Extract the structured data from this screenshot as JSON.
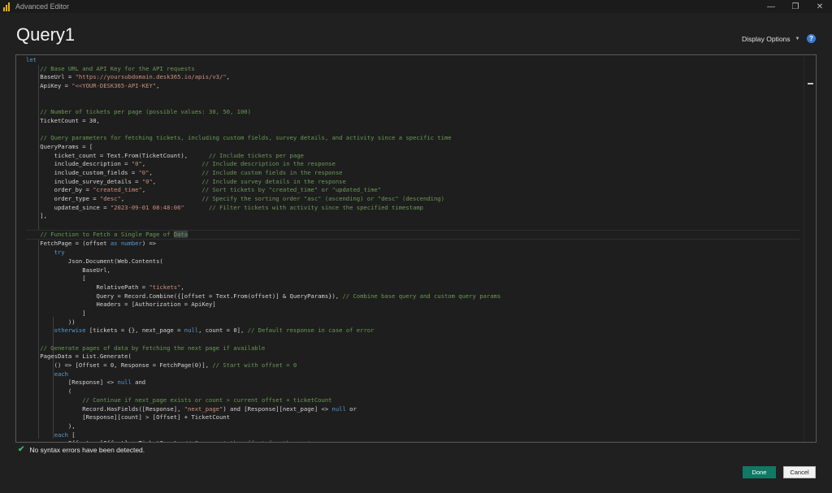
{
  "window": {
    "title": "Advanced Editor",
    "controls": {
      "minimize": "—",
      "restore": "❐",
      "close": "✕"
    }
  },
  "header": {
    "query_name": "Query1",
    "display_options_label": "Display Options",
    "help_label": "?"
  },
  "editor": {
    "lines": [
      [
        {
          "t": "let",
          "c": "kw"
        }
      ],
      [
        {
          "t": "    "
        },
        {
          "t": "// Base URL and API Key for the API requests",
          "c": "cm"
        }
      ],
      [
        {
          "t": "    BaseUrl = "
        },
        {
          "t": "\"https://yoursubdomain.desk365.io/apis/v3/\"",
          "c": "st"
        },
        {
          "t": ","
        }
      ],
      [
        {
          "t": "    ApiKey = "
        },
        {
          "t": "\"<<YOUR-DESK365-API-KEY\"",
          "c": "st"
        },
        {
          "t": ","
        }
      ],
      [],
      [],
      [
        {
          "t": "    "
        },
        {
          "t": "// Number of tickets per page (possible values: 30, 50, 100)",
          "c": "cm"
        }
      ],
      [
        {
          "t": "    TicketCount = 30,"
        }
      ],
      [],
      [
        {
          "t": "    "
        },
        {
          "t": "// Query parameters for fetching tickets, including custom fields, survey details, and activity since a specific time",
          "c": "cm"
        }
      ],
      [
        {
          "t": "    QueryParams = ["
        }
      ],
      [
        {
          "t": "        ticket_count = Text.From(TicketCount),      "
        },
        {
          "t": "// Include tickets per page",
          "c": "cm"
        }
      ],
      [
        {
          "t": "        include_description = "
        },
        {
          "t": "\"0\"",
          "c": "st"
        },
        {
          "t": ",                "
        },
        {
          "t": "// Include description in the response",
          "c": "cm"
        }
      ],
      [
        {
          "t": "        include_custom_fields = "
        },
        {
          "t": "\"0\"",
          "c": "st"
        },
        {
          "t": ",              "
        },
        {
          "t": "// Include custom fields in the response",
          "c": "cm"
        }
      ],
      [
        {
          "t": "        include_survey_details = "
        },
        {
          "t": "\"0\"",
          "c": "st"
        },
        {
          "t": ",             "
        },
        {
          "t": "// Include survey details in the response",
          "c": "cm"
        }
      ],
      [
        {
          "t": "        order_by = "
        },
        {
          "t": "\"created_time\"",
          "c": "st"
        },
        {
          "t": ",                "
        },
        {
          "t": "// Sort tickets by \"created_time\" or \"updated_time\"",
          "c": "cm"
        }
      ],
      [
        {
          "t": "        order_type = "
        },
        {
          "t": "\"desc\"",
          "c": "st"
        },
        {
          "t": ",                      "
        },
        {
          "t": "// Specify the sorting order \"asc\" (ascending) or \"desc\" (descending)",
          "c": "cm"
        }
      ],
      [
        {
          "t": "        updated_since = "
        },
        {
          "t": "\"2023-09-01 08:48:06\"",
          "c": "st"
        },
        {
          "t": "       "
        },
        {
          "t": "// Filter tickets with activity since the specified timestamp",
          "c": "cm"
        }
      ],
      [
        {
          "t": "    ],"
        }
      ],
      [],
      [
        {
          "t": "    "
        },
        {
          "t": "// Function to Fetch a Single Page of ",
          "c": "cm"
        },
        {
          "t": "Data",
          "c": "cm hl"
        }
      ],
      [
        {
          "t": "    FetchPage = (offset "
        },
        {
          "t": "as",
          "c": "kw"
        },
        {
          "t": " "
        },
        {
          "t": "number",
          "c": "kw"
        },
        {
          "t": ") =>"
        }
      ],
      [
        {
          "t": "        "
        },
        {
          "t": "try",
          "c": "kw"
        }
      ],
      [
        {
          "t": "            Json.Document(Web.Contents("
        }
      ],
      [
        {
          "t": "                BaseUrl,"
        }
      ],
      [
        {
          "t": "                ["
        }
      ],
      [
        {
          "t": "                    RelativePath = "
        },
        {
          "t": "\"tickets\"",
          "c": "st"
        },
        {
          "t": ","
        }
      ],
      [
        {
          "t": "                    Query = Record.Combine({[offset = Text.From(offset)] & QueryParams}), "
        },
        {
          "t": "// Combine base query and custom query params",
          "c": "cm"
        }
      ],
      [
        {
          "t": "                    Headers = [Authorization = ApiKey]"
        }
      ],
      [
        {
          "t": "                ]"
        }
      ],
      [
        {
          "t": "            ))"
        }
      ],
      [
        {
          "t": "        "
        },
        {
          "t": "otherwise",
          "c": "kw"
        },
        {
          "t": " [tickets = {}, next_page = "
        },
        {
          "t": "null",
          "c": "kw"
        },
        {
          "t": ", count = 0], "
        },
        {
          "t": "// Default response in case of error",
          "c": "cm"
        }
      ],
      [],
      [
        {
          "t": "    "
        },
        {
          "t": "// Generate pages of data by fetching the next page if available",
          "c": "cm"
        }
      ],
      [
        {
          "t": "    PagesData = List.Generate("
        }
      ],
      [
        {
          "t": "        () => [Offset = 0, Response = FetchPage(0)], "
        },
        {
          "t": "// Start with offset = 0",
          "c": "cm"
        }
      ],
      [
        {
          "t": "        "
        },
        {
          "t": "each",
          "c": "kw"
        }
      ],
      [
        {
          "t": "            [Response] <> "
        },
        {
          "t": "null",
          "c": "kw"
        },
        {
          "t": " and"
        }
      ],
      [
        {
          "t": "            ("
        }
      ],
      [
        {
          "t": "                "
        },
        {
          "t": "// Continue if next_page exists or count > current offset + ticketCount",
          "c": "cm"
        }
      ],
      [
        {
          "t": "                Record.HasFields([Response], "
        },
        {
          "t": "\"next_page\"",
          "c": "st"
        },
        {
          "t": ") and [Response][next_page] <> "
        },
        {
          "t": "null",
          "c": "kw"
        },
        {
          "t": " or"
        }
      ],
      [
        {
          "t": "                [Response][count] > [Offset] + TicketCount"
        }
      ],
      [
        {
          "t": "            ),"
        }
      ],
      [
        {
          "t": "        "
        },
        {
          "t": "each",
          "c": "kw"
        },
        {
          "t": " ["
        }
      ],
      [
        {
          "t": "            Offset = [Offset] + TicketCount, "
        },
        {
          "t": "// Increment the offset for the next page",
          "c": "cm"
        }
      ]
    ]
  },
  "status": {
    "message": "No syntax errors have been detected."
  },
  "footer": {
    "done_label": "Done",
    "cancel_label": "Cancel"
  }
}
